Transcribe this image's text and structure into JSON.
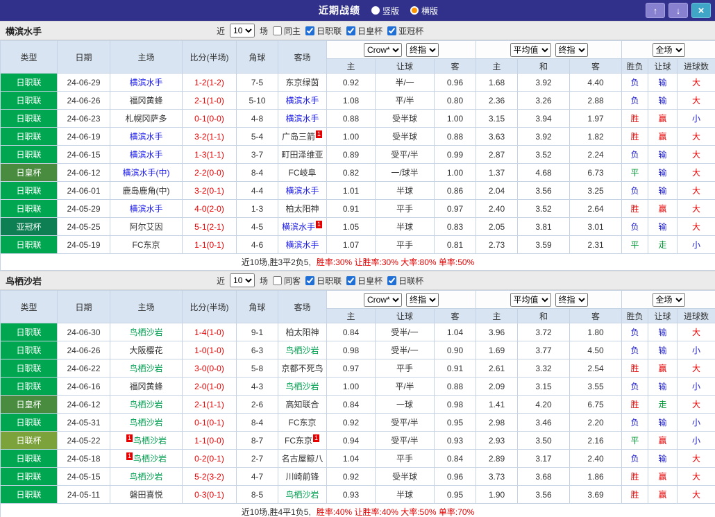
{
  "titlebar": {
    "title": "近期战绩",
    "layout_options": [
      {
        "label": "竖版",
        "selected": false
      },
      {
        "label": "横版",
        "selected": true
      }
    ],
    "icons": {
      "up": "↑",
      "down": "↓",
      "close": "×"
    }
  },
  "colors": {
    "league": {
      "日职联": "#00a650",
      "日皇杯": "#4a8c3f",
      "亚冠杯": "#0d7f52",
      "日联杯": "#7ca23c"
    },
    "result": {
      "胜": "#e60000",
      "平": "#009933",
      "负": "#2222cc",
      "赢": "#e60000",
      "走": "#009933",
      "输": "#2222cc",
      "大": "#e60000",
      "小": "#2222cc"
    }
  },
  "table_header": {
    "main": [
      "类型",
      "日期",
      "主场",
      "比分(半场)",
      "角球",
      "客场"
    ],
    "sub": [
      "主",
      "让球",
      "客",
      "主",
      "和",
      "客",
      "胜负",
      "让球",
      "进球数"
    ],
    "selects": {
      "book": "Crow*",
      "final_a": "终指",
      "avg": "平均值",
      "final_b": "终指",
      "scope": "全场"
    }
  },
  "sections": [
    {
      "team": "横滨水手",
      "focal_color": "#1a1aee",
      "filter": {
        "near": "近",
        "count": "10",
        "games": "场",
        "same": {
          "label": "同主",
          "checked": false
        },
        "leagues": [
          {
            "label": "日职联",
            "checked": true
          },
          {
            "label": "日皇杯",
            "checked": true
          },
          {
            "label": "亚冠杯",
            "checked": true
          }
        ]
      },
      "rows": [
        {
          "league": "日职联",
          "date": "24-06-29",
          "home": "横滨水手",
          "home_focal": true,
          "home_mark": "",
          "score": "1-2(1-2)",
          "corner": "7-5",
          "away": "东京绿茵",
          "away_focal": false,
          "away_mark": "",
          "crow": [
            "0.92",
            "半/一",
            "0.96"
          ],
          "avg": [
            "1.68",
            "3.92",
            "4.40"
          ],
          "res": [
            "负",
            "输",
            "大"
          ]
        },
        {
          "league": "日职联",
          "date": "24-06-26",
          "home": "福冈黄蜂",
          "home_focal": false,
          "home_mark": "",
          "score": "2-1(1-0)",
          "corner": "5-10",
          "away": "横滨水手",
          "away_focal": true,
          "away_mark": "",
          "crow": [
            "1.08",
            "平/半",
            "0.80"
          ],
          "avg": [
            "2.36",
            "3.26",
            "2.88"
          ],
          "res": [
            "负",
            "输",
            "大"
          ]
        },
        {
          "league": "日职联",
          "date": "24-06-23",
          "home": "札幌冈萨多",
          "home_focal": false,
          "home_mark": "",
          "score": "0-1(0-0)",
          "corner": "4-8",
          "away": "横滨水手",
          "away_focal": true,
          "away_mark": "",
          "crow": [
            "0.88",
            "受半球",
            "1.00"
          ],
          "avg": [
            "3.15",
            "3.94",
            "1.97"
          ],
          "res": [
            "胜",
            "赢",
            "小"
          ]
        },
        {
          "league": "日职联",
          "date": "24-06-19",
          "home": "横滨水手",
          "home_focal": true,
          "home_mark": "",
          "score": "3-2(1-1)",
          "corner": "5-4",
          "away": "广岛三箭",
          "away_focal": false,
          "away_mark": "1",
          "crow": [
            "1.00",
            "受半球",
            "0.88"
          ],
          "avg": [
            "3.63",
            "3.92",
            "1.82"
          ],
          "res": [
            "胜",
            "赢",
            "大"
          ]
        },
        {
          "league": "日职联",
          "date": "24-06-15",
          "home": "横滨水手",
          "home_focal": true,
          "home_mark": "",
          "score": "1-3(1-1)",
          "corner": "3-7",
          "away": "町田泽维亚",
          "away_focal": false,
          "away_mark": "",
          "crow": [
            "0.89",
            "受平/半",
            "0.99"
          ],
          "avg": [
            "2.87",
            "3.52",
            "2.24"
          ],
          "res": [
            "负",
            "输",
            "大"
          ]
        },
        {
          "league": "日皇杯",
          "date": "24-06-12",
          "home": "横滨水手(中)",
          "home_focal": true,
          "home_mark": "",
          "score": "2-2(0-0)",
          "corner": "8-4",
          "away": "FC岐阜",
          "away_focal": false,
          "away_mark": "",
          "crow": [
            "0.82",
            "一/球半",
            "1.00"
          ],
          "avg": [
            "1.37",
            "4.68",
            "6.73"
          ],
          "res": [
            "平",
            "输",
            "大"
          ]
        },
        {
          "league": "日职联",
          "date": "24-06-01",
          "home": "鹿岛鹿角(中)",
          "home_focal": false,
          "home_mark": "",
          "score": "3-2(0-1)",
          "corner": "4-4",
          "away": "横滨水手",
          "away_focal": true,
          "away_mark": "",
          "crow": [
            "1.01",
            "半球",
            "0.86"
          ],
          "avg": [
            "2.04",
            "3.56",
            "3.25"
          ],
          "res": [
            "负",
            "输",
            "大"
          ]
        },
        {
          "league": "日职联",
          "date": "24-05-29",
          "home": "横滨水手",
          "home_focal": true,
          "home_mark": "",
          "score": "4-0(2-0)",
          "corner": "1-3",
          "away": "柏太阳神",
          "away_focal": false,
          "away_mark": "",
          "crow": [
            "0.91",
            "平手",
            "0.97"
          ],
          "avg": [
            "2.40",
            "3.52",
            "2.64"
          ],
          "res": [
            "胜",
            "赢",
            "大"
          ]
        },
        {
          "league": "亚冠杯",
          "date": "24-05-25",
          "home": "阿尔艾因",
          "home_focal": false,
          "home_mark": "",
          "score": "5-1(2-1)",
          "corner": "4-5",
          "away": "横滨水手",
          "away_focal": true,
          "away_mark": "1",
          "crow": [
            "1.05",
            "半球",
            "0.83"
          ],
          "avg": [
            "2.05",
            "3.81",
            "3.01"
          ],
          "res": [
            "负",
            "输",
            "大"
          ]
        },
        {
          "league": "日职联",
          "date": "24-05-19",
          "home": "FC东京",
          "home_focal": false,
          "home_mark": "",
          "score": "1-1(0-1)",
          "corner": "4-6",
          "away": "横滨水手",
          "away_focal": true,
          "away_mark": "",
          "crow": [
            "1.07",
            "平手",
            "0.81"
          ],
          "avg": [
            "2.73",
            "3.59",
            "2.31"
          ],
          "res": [
            "平",
            "走",
            "小"
          ]
        }
      ],
      "summary": {
        "prefix": "近10场,胜3平2负5,",
        "stats": "胜率:30% 让胜率:30% 大率:80% 单率:50%"
      }
    },
    {
      "team": "鸟栖沙岩",
      "focal_color": "#00a050",
      "filter": {
        "near": "近",
        "count": "10",
        "games": "场",
        "same": {
          "label": "同客",
          "checked": false
        },
        "leagues": [
          {
            "label": "日职联",
            "checked": true
          },
          {
            "label": "日皇杯",
            "checked": true
          },
          {
            "label": "日联杯",
            "checked": true
          }
        ]
      },
      "rows": [
        {
          "league": "日职联",
          "date": "24-06-30",
          "home": "鸟栖沙岩",
          "home_focal": true,
          "home_mark": "",
          "score": "1-4(1-0)",
          "corner": "9-1",
          "away": "柏太阳神",
          "away_focal": false,
          "away_mark": "",
          "crow": [
            "0.84",
            "受半/一",
            "1.04"
          ],
          "avg": [
            "3.96",
            "3.72",
            "1.80"
          ],
          "res": [
            "负",
            "输",
            "大"
          ]
        },
        {
          "league": "日职联",
          "date": "24-06-26",
          "home": "大阪樱花",
          "home_focal": false,
          "home_mark": "",
          "score": "1-0(1-0)",
          "corner": "6-3",
          "away": "鸟栖沙岩",
          "away_focal": true,
          "away_mark": "",
          "crow": [
            "0.98",
            "受半/一",
            "0.90"
          ],
          "avg": [
            "1.69",
            "3.77",
            "4.50"
          ],
          "res": [
            "负",
            "输",
            "小"
          ]
        },
        {
          "league": "日职联",
          "date": "24-06-22",
          "home": "鸟栖沙岩",
          "home_focal": true,
          "home_mark": "",
          "score": "3-0(0-0)",
          "corner": "5-8",
          "away": "京都不死鸟",
          "away_focal": false,
          "away_mark": "",
          "crow": [
            "0.97",
            "平手",
            "0.91"
          ],
          "avg": [
            "2.61",
            "3.32",
            "2.54"
          ],
          "res": [
            "胜",
            "赢",
            "大"
          ]
        },
        {
          "league": "日职联",
          "date": "24-06-16",
          "home": "福冈黄蜂",
          "home_focal": false,
          "home_mark": "",
          "score": "2-0(1-0)",
          "corner": "4-3",
          "away": "鸟栖沙岩",
          "away_focal": true,
          "away_mark": "",
          "crow": [
            "1.00",
            "平/半",
            "0.88"
          ],
          "avg": [
            "2.09",
            "3.15",
            "3.55"
          ],
          "res": [
            "负",
            "输",
            "小"
          ]
        },
        {
          "league": "日皇杯",
          "date": "24-06-12",
          "home": "鸟栖沙岩",
          "home_focal": true,
          "home_mark": "",
          "score": "2-1(1-1)",
          "corner": "2-6",
          "away": "高知联合",
          "away_focal": false,
          "away_mark": "",
          "crow": [
            "0.84",
            "一球",
            "0.98"
          ],
          "avg": [
            "1.41",
            "4.20",
            "6.75"
          ],
          "res": [
            "胜",
            "走",
            "大"
          ]
        },
        {
          "league": "日职联",
          "date": "24-05-31",
          "home": "鸟栖沙岩",
          "home_focal": true,
          "home_mark": "",
          "score": "0-1(0-1)",
          "corner": "8-4",
          "away": "FC东京",
          "away_focal": false,
          "away_mark": "",
          "crow": [
            "0.92",
            "受平/半",
            "0.95"
          ],
          "avg": [
            "2.98",
            "3.46",
            "2.20"
          ],
          "res": [
            "负",
            "输",
            "小"
          ]
        },
        {
          "league": "日联杯",
          "date": "24-05-22",
          "home": "鸟栖沙岩",
          "home_focal": true,
          "home_mark": "1",
          "score": "1-1(0-0)",
          "corner": "8-7",
          "away": "FC东京",
          "away_focal": false,
          "away_mark": "1",
          "crow": [
            "0.94",
            "受平/半",
            "0.93"
          ],
          "avg": [
            "2.93",
            "3.50",
            "2.16"
          ],
          "res": [
            "平",
            "赢",
            "小"
          ]
        },
        {
          "league": "日职联",
          "date": "24-05-18",
          "home": "鸟栖沙岩",
          "home_focal": true,
          "home_mark": "1",
          "score": "0-2(0-1)",
          "corner": "2-7",
          "away": "名古屋鲸八",
          "away_focal": false,
          "away_mark": "",
          "crow": [
            "1.04",
            "平手",
            "0.84"
          ],
          "avg": [
            "2.89",
            "3.17",
            "2.40"
          ],
          "res": [
            "负",
            "输",
            "大"
          ]
        },
        {
          "league": "日职联",
          "date": "24-05-15",
          "home": "鸟栖沙岩",
          "home_focal": true,
          "home_mark": "",
          "score": "5-2(3-2)",
          "corner": "4-7",
          "away": "川崎前锋",
          "away_focal": false,
          "away_mark": "",
          "crow": [
            "0.92",
            "受半球",
            "0.96"
          ],
          "avg": [
            "3.73",
            "3.68",
            "1.86"
          ],
          "res": [
            "胜",
            "赢",
            "大"
          ]
        },
        {
          "league": "日职联",
          "date": "24-05-11",
          "home": "磐田喜悦",
          "home_focal": false,
          "home_mark": "",
          "score": "0-3(0-1)",
          "corner": "8-5",
          "away": "鸟栖沙岩",
          "away_focal": true,
          "away_mark": "",
          "crow": [
            "0.93",
            "半球",
            "0.95"
          ],
          "avg": [
            "1.90",
            "3.56",
            "3.69"
          ],
          "res": [
            "胜",
            "赢",
            "大"
          ]
        }
      ],
      "summary": {
        "prefix": "近10场,胜4平1负5,",
        "stats": "胜率:40% 让胜率:40% 大率:50% 单率:70%"
      }
    }
  ]
}
